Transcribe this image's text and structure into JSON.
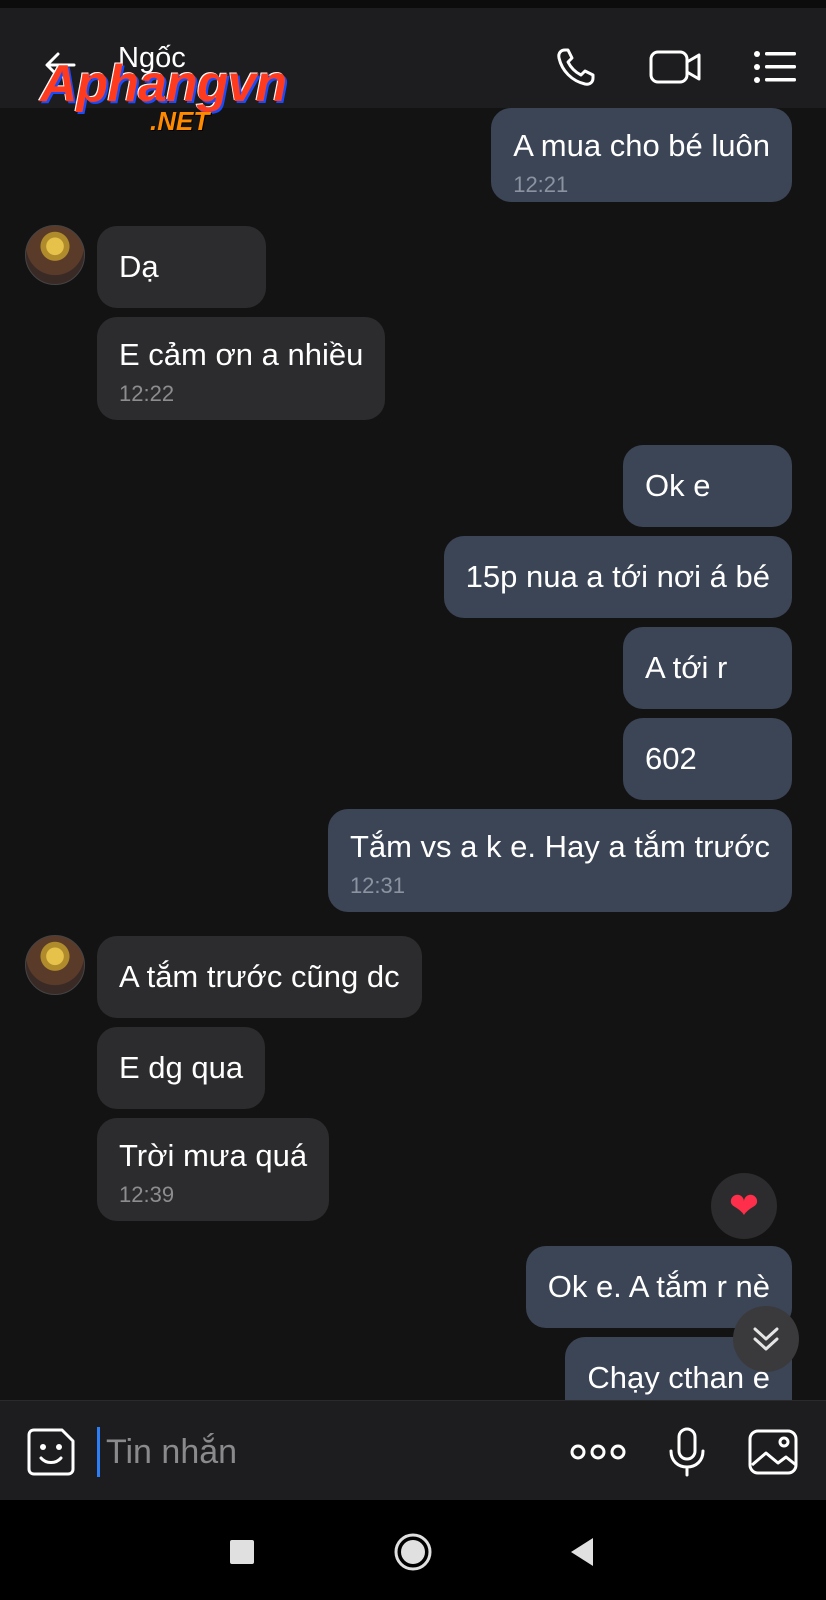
{
  "header": {
    "contact_name": "Ngốc",
    "watermark_main": "Aphangvn",
    "watermark_sub": ".NET"
  },
  "messages": [
    {
      "dir": "out",
      "text": "A mua cho bé luôn",
      "time": "12:21"
    },
    {
      "dir": "in",
      "text": "Dạ"
    },
    {
      "dir": "in",
      "text": "E cảm ơn a nhiều",
      "time": "12:22"
    },
    {
      "dir": "out",
      "text": "Ok e"
    },
    {
      "dir": "out",
      "text": "15p nua a tới nơi á bé"
    },
    {
      "dir": "out",
      "text": "A tới r"
    },
    {
      "dir": "out",
      "text": "602"
    },
    {
      "dir": "out",
      "text": "Tắm vs a k e. Hay a tắm trước",
      "time": "12:31"
    },
    {
      "dir": "in",
      "text": "A tắm trước cũng dc"
    },
    {
      "dir": "in",
      "text": "E dg qua"
    },
    {
      "dir": "in",
      "text": "Trời mưa quá",
      "time": "12:39"
    },
    {
      "dir": "out",
      "text": "Ok e. A tắm r nè"
    },
    {
      "dir": "out",
      "text": "Chạy cthan e"
    }
  ],
  "reaction": "❤",
  "composer": {
    "placeholder": "Tin nhắn",
    "value": ""
  },
  "icons": {
    "back": "arrow-left-icon",
    "call": "phone-icon",
    "video": "video-camera-icon",
    "menu": "list-menu-icon",
    "sticker": "sticker-smiley-icon",
    "more": "more-dots-icon",
    "mic": "microphone-icon",
    "image": "image-icon",
    "scroll_down": "double-chevron-down-icon"
  },
  "colors": {
    "background": "#131313",
    "header": "#1d1d1f",
    "bubble_out": "#3b4555",
    "bubble_in": "#2c2c2e",
    "caret": "#2d7ff9",
    "heart": "#ff2e4a"
  }
}
